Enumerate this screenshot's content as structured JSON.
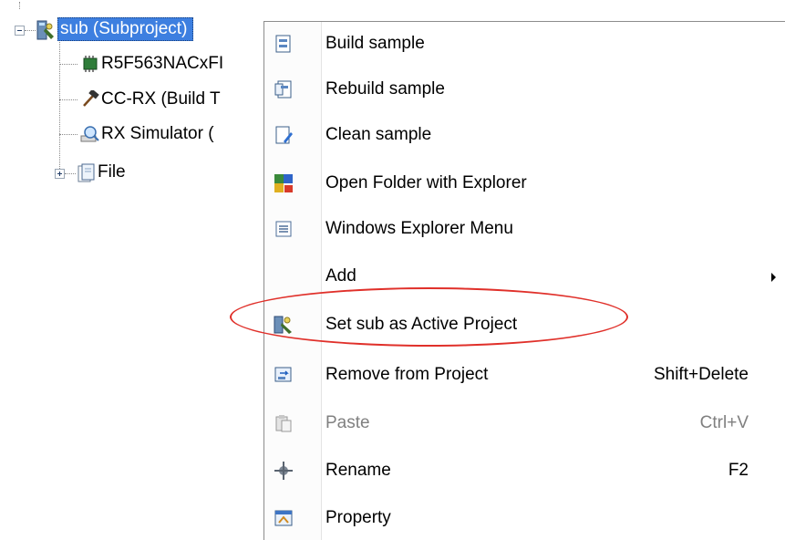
{
  "tree": {
    "root": {
      "label": "sub (Subproject)",
      "icon": "subproject-icon",
      "expanded": true
    },
    "children": [
      {
        "label": "R5F563NACxFI",
        "icon": "microcontroller-icon"
      },
      {
        "label": "CC-RX (Build T",
        "icon": "build-tool-hammer-icon"
      },
      {
        "label": "RX Simulator (",
        "icon": "debug-tool-simulator-icon"
      },
      {
        "label": "File",
        "icon": "file-folder-icon",
        "expanded": false
      }
    ]
  },
  "context_menu": {
    "items": [
      {
        "label": "Build sample",
        "shortcut": "",
        "icon": "build-icon",
        "enabled": true
      },
      {
        "label": "Rebuild sample",
        "shortcut": "",
        "icon": "rebuild-icon",
        "enabled": true
      },
      {
        "label": "Clean sample",
        "shortcut": "",
        "icon": "clean-icon",
        "enabled": true
      },
      {
        "label": "Open Folder with Explorer",
        "shortcut": "",
        "icon": "open-folder-icon",
        "enabled": true
      },
      {
        "label": "Windows Explorer Menu",
        "shortcut": "",
        "icon": "explorer-menu-icon",
        "enabled": true
      },
      {
        "label": "Add",
        "shortcut": "",
        "icon": "",
        "enabled": true,
        "submenu": true
      },
      {
        "label": "Set sub as Active Project",
        "shortcut": "",
        "icon": "set-active-project-icon",
        "enabled": true,
        "highlighted": true
      },
      {
        "label": "Remove from Project",
        "shortcut": "Shift+Delete",
        "icon": "remove-from-project-icon",
        "enabled": true
      },
      {
        "label": "Paste",
        "shortcut": "Ctrl+V",
        "icon": "paste-icon",
        "enabled": false
      },
      {
        "label": "Rename",
        "shortcut": "F2",
        "icon": "rename-icon",
        "enabled": true
      },
      {
        "label": "Property",
        "shortcut": "",
        "icon": "property-icon",
        "enabled": true
      }
    ]
  },
  "colors": {
    "selection": "#3d7fe0",
    "highlight_ellipse": "#e0302a",
    "disabled_text": "#808080"
  }
}
